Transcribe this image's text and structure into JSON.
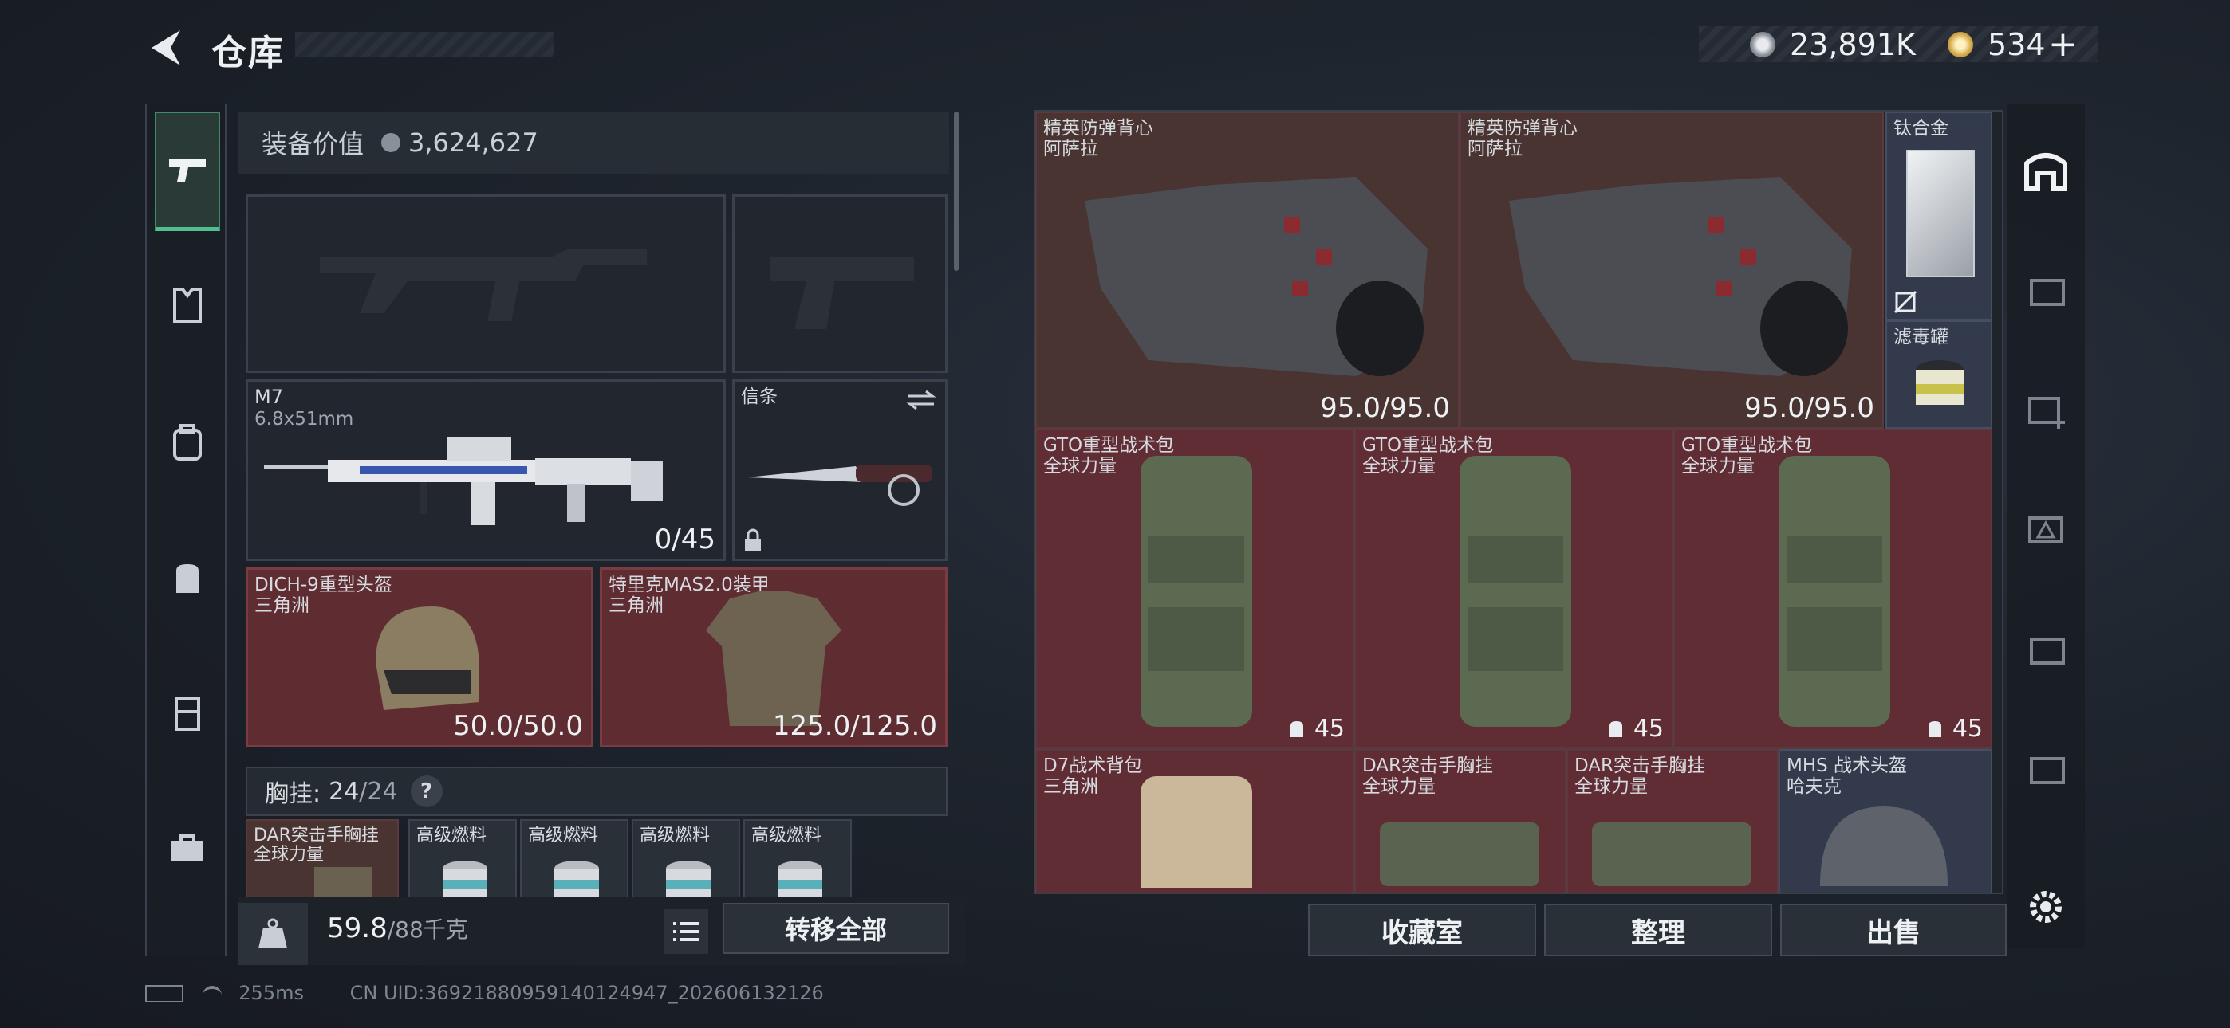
{
  "header": {
    "title": "仓库",
    "currency": [
      {
        "icon": "silver-coin-icon",
        "value": "23,891K"
      },
      {
        "icon": "gold-coin-icon",
        "value": "534",
        "plus": "+"
      }
    ]
  },
  "loadout": {
    "equip_value_label": "装备价值",
    "equip_value": "3,624,627",
    "primary": {
      "name": "M7",
      "ammo": "6.8x51mm",
      "count": "0/45"
    },
    "melee": {
      "name": "信条"
    },
    "helmet": {
      "name": "DICH-9重型头盔",
      "faction": "三角洲",
      "durability": "50.0/50.0"
    },
    "armor": {
      "name": "特里克MAS2.0装甲",
      "faction": "三角洲",
      "durability": "125.0/125.0"
    },
    "chest_rig": {
      "label": "胸挂:",
      "used": "24",
      "total": "/24",
      "help": "?"
    },
    "chest_items": [
      {
        "name": "DAR突击手胸挂",
        "sub": "全球力量"
      },
      {
        "name": "高级燃料"
      },
      {
        "name": "高级燃料"
      },
      {
        "name": "高级燃料"
      },
      {
        "name": "高级燃料"
      }
    ],
    "weight": "59.8",
    "weight_max": "/88千克",
    "transfer_all": "转移全部"
  },
  "storage": {
    "items": [
      {
        "name": "精英防弹背心",
        "sub": "阿萨拉",
        "value": "95.0/95.0"
      },
      {
        "name": "精英防弹背心",
        "sub": "阿萨拉",
        "value": "95.0/95.0"
      },
      {
        "name": "钛合金"
      },
      {
        "name": "滤毒罐"
      },
      {
        "name": "GTO重型战术包",
        "sub": "全球力量",
        "value": "45"
      },
      {
        "name": "GTO重型战术包",
        "sub": "全球力量",
        "value": "45"
      },
      {
        "name": "GTO重型战术包",
        "sub": "全球力量",
        "value": "45"
      },
      {
        "name": "D7战术背包",
        "sub": "三角洲"
      },
      {
        "name": "DAR突击手胸挂",
        "sub": "全球力量"
      },
      {
        "name": "DAR突击手胸挂",
        "sub": "全球力量"
      },
      {
        "name": "MHS 战术头盔",
        "sub": "哈夫克"
      }
    ],
    "buttons": {
      "collection": "收藏室",
      "organize": "整理",
      "sell": "出售"
    }
  },
  "status": {
    "ping": "255ms",
    "uid": "CN UID:3692188095914012494​7_202606132126"
  },
  "colors": {
    "accent": "#4fbf8e",
    "red_slot": "#5f2d33",
    "brown_slot": "#4a3432",
    "blue_slot": "#323a4c"
  }
}
